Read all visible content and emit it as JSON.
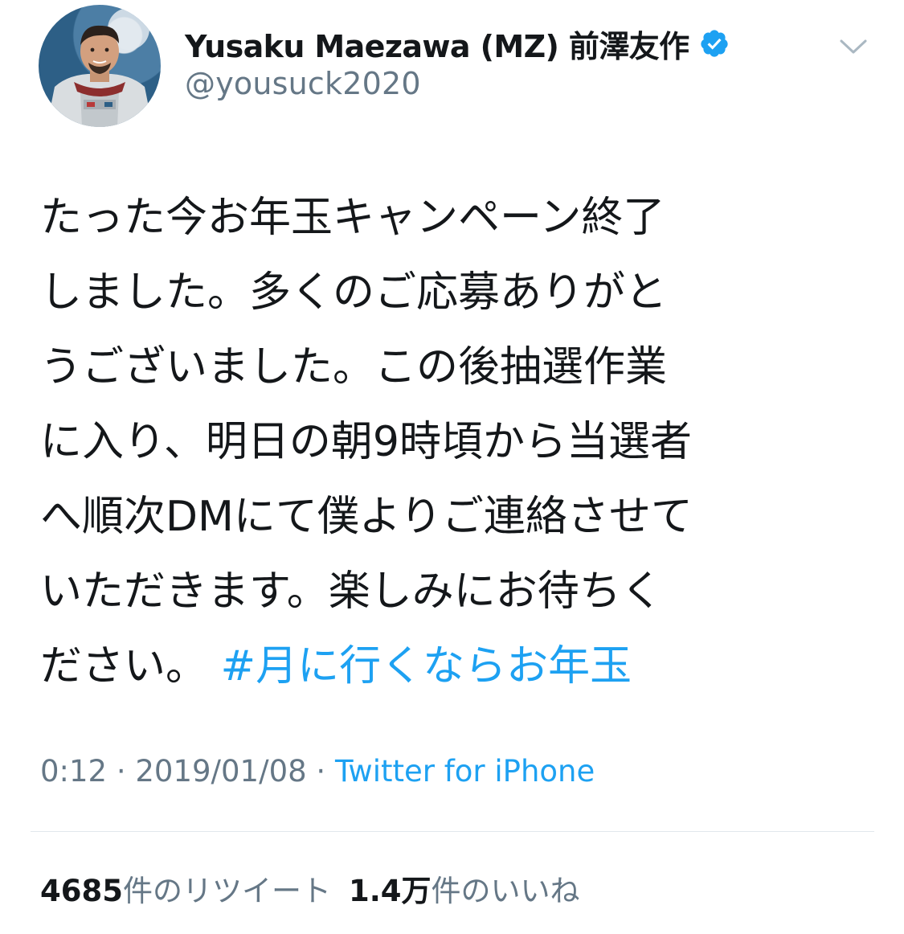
{
  "author": {
    "display_name": "Yusaku Maezawa (MZ) 前澤友作",
    "handle": "@yousuck2020",
    "verified": true,
    "avatar_icon": "astronaut-portrait-avatar"
  },
  "tweet": {
    "lines": [
      "たった今お年玉キャンペーン終了",
      "しました。多くのご応募ありがと",
      "うございました。この後抽選作業",
      "に入り、明日の朝9時頃から当選者",
      "へ順次DMにて僕よりご連絡させて",
      "いただきます。楽しみにお待ちく"
    ],
    "last_line_text": "ださい。",
    "hashtag": "#月に行くならお年玉"
  },
  "meta": {
    "time": "0:12",
    "separator": "·",
    "date": "2019/01/08",
    "source": "Twitter for iPhone"
  },
  "stats": {
    "retweets_count": "4685",
    "retweets_label": "件のリツイート",
    "likes_count": "1.4万",
    "likes_label": "件のいいね"
  },
  "colors": {
    "link": "#1da1f2",
    "secondary_text": "#657786",
    "primary_text": "#14171a",
    "divider": "#e1e8ed"
  }
}
